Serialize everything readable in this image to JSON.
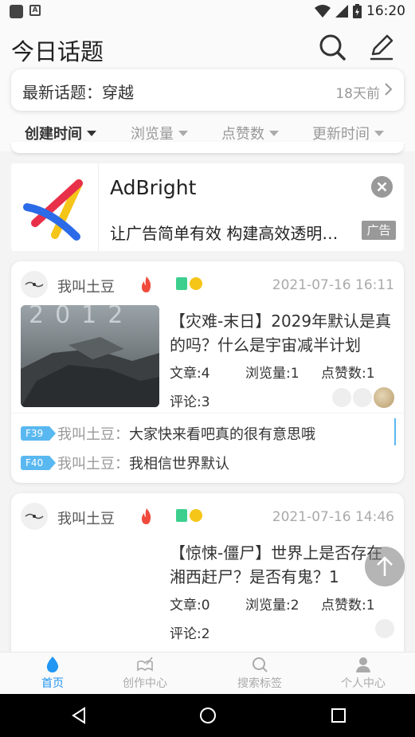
{
  "status_bar": {
    "time": "16:20"
  },
  "header": {
    "title": "今日话题",
    "latest_topic": {
      "label": "最新话题：穿越",
      "time": "18天前"
    },
    "sort_options": [
      {
        "label": "创建时间",
        "active": true
      },
      {
        "label": "浏览量",
        "active": false
      },
      {
        "label": "点赞数",
        "active": false
      },
      {
        "label": "更新时间",
        "active": false
      }
    ]
  },
  "ad": {
    "name": "AdBright",
    "description": "让广告简单有效 构建高效透明…",
    "badge": "广告"
  },
  "posts": [
    {
      "author": "我叫土豆",
      "date": "2021-07-16 16:11",
      "title": "【灾难-末日】2029年默认是真的吗？什么是宇宙减半计划",
      "stats": {
        "articles": "文章:4",
        "views": "浏览量:1",
        "likes": "点赞数:1"
      },
      "comments_count": "评论:3",
      "comments": [
        {
          "floor": "F39",
          "author": "我叫土豆：",
          "text": "大家快来看吧真的很有意思哦"
        },
        {
          "floor": "F40",
          "author": "我叫土豆：",
          "text": "我相信世界默认"
        }
      ]
    },
    {
      "author": "我叫土豆",
      "date": "2021-07-16 14:46",
      "title": "【惊悚-僵尸】世界上是否存在湘西赶尸？是否有鬼？1",
      "stats": {
        "articles": "文章:0",
        "views": "浏览量:2",
        "likes": "点赞数:1"
      },
      "comments_count": "评论:2"
    }
  ],
  "bottom_nav": [
    {
      "label": "首页",
      "icon": "drop-icon",
      "active": true
    },
    {
      "label": "创作中心",
      "icon": "book-pen-icon",
      "active": false
    },
    {
      "label": "搜索标签",
      "icon": "search-icon",
      "active": false
    },
    {
      "label": "个人中心",
      "icon": "person-icon",
      "active": false
    }
  ],
  "colors": {
    "accent": "#2196f3",
    "floor_tag": "#5ab8f0",
    "fire": "#f04a3c",
    "level_green": "#3ccf8e",
    "level_gold": "#f5c518"
  }
}
